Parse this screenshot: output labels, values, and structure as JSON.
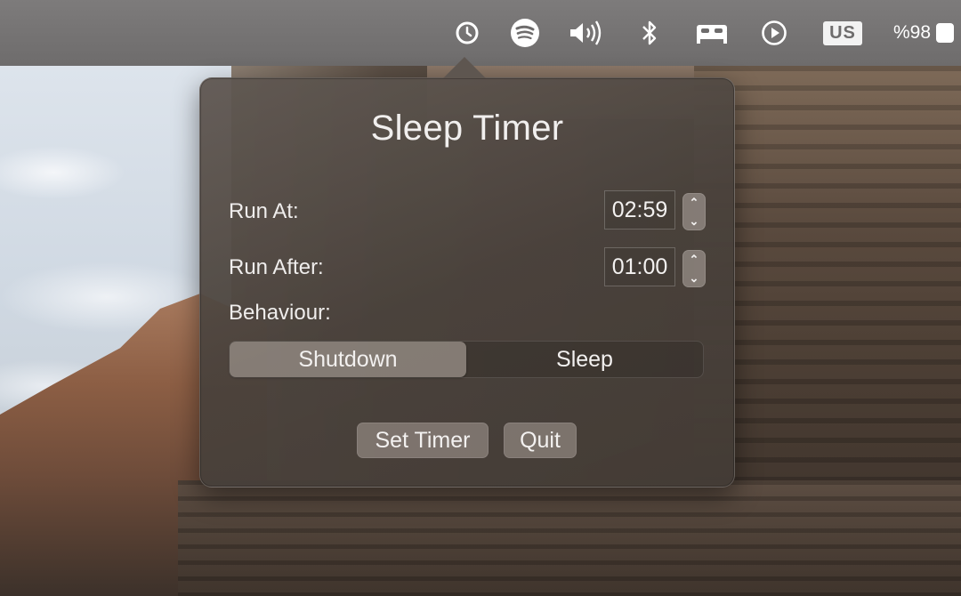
{
  "menubar": {
    "icons": [
      "clock-icon",
      "spotify-icon",
      "volume-icon",
      "bluetooth-icon",
      "bed-icon",
      "play-icon"
    ],
    "input_source": "US",
    "battery_text": "%98"
  },
  "popover": {
    "title": "Sleep Timer",
    "run_at": {
      "label": "Run At:",
      "value": "02:59"
    },
    "run_after": {
      "label": "Run After:",
      "value": "01:00"
    },
    "behaviour": {
      "label": "Behaviour:",
      "options": [
        "Shutdown",
        "Sleep"
      ],
      "selected": "Shutdown"
    },
    "buttons": {
      "set_timer": "Set Timer",
      "quit": "Quit"
    }
  },
  "colors": {
    "menubar": "#7d7b7b",
    "popover": "#5a524c",
    "text": "#f1efee"
  }
}
